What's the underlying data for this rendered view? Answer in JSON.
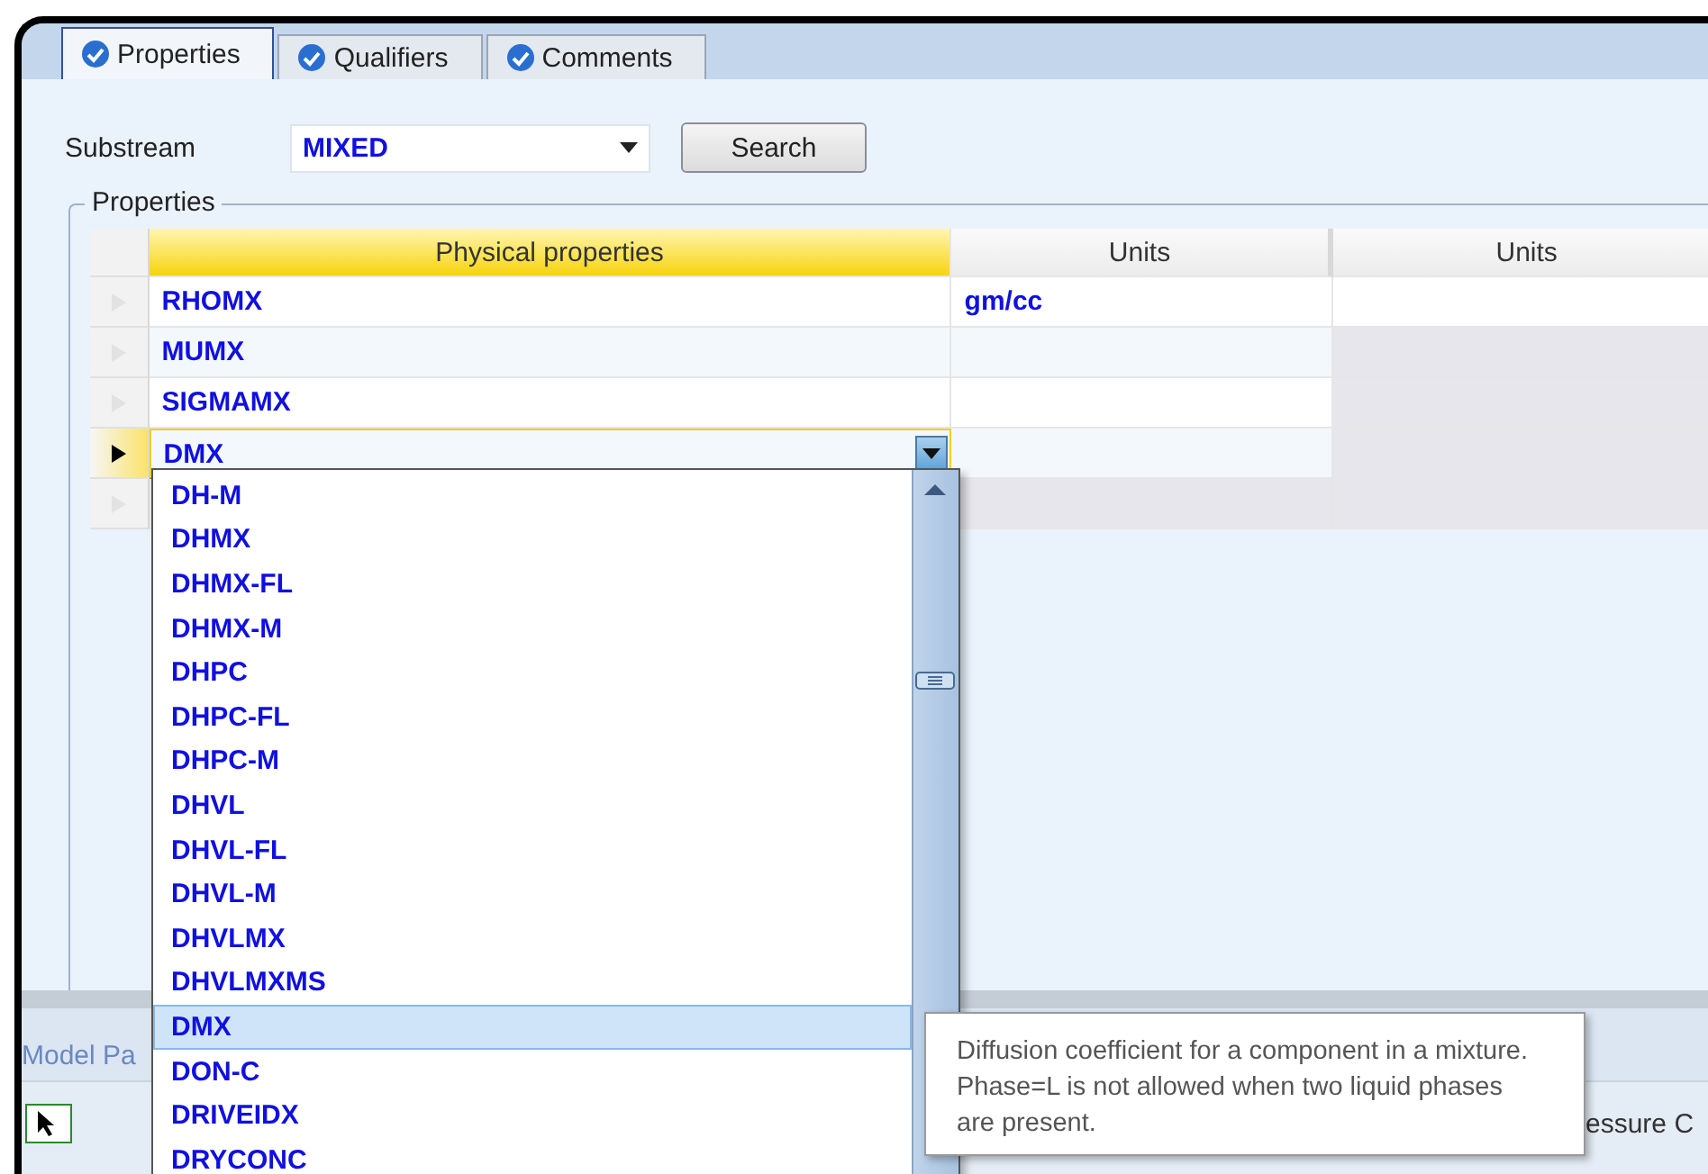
{
  "tabs": [
    {
      "label": "Properties",
      "selected": true
    },
    {
      "label": "Qualifiers",
      "selected": false
    },
    {
      "label": "Comments",
      "selected": false
    }
  ],
  "substream": {
    "label": "Substream",
    "value": "MIXED"
  },
  "search_button": "Search",
  "group_title": "Properties",
  "grid": {
    "columns": [
      "Physical properties",
      "Units",
      "Units"
    ],
    "rows": [
      {
        "name": "RHOMX",
        "units": "gm/cc",
        "units_2_disabled": false,
        "selected": false
      },
      {
        "name": "MUMX",
        "units_2_disabled": true,
        "selected": false
      },
      {
        "name": "SIGMAMX",
        "units_2_disabled": true,
        "selected": false
      },
      {
        "name": "DMX",
        "units_2_disabled": true,
        "selected": true
      },
      {
        "units_2_disabled": true,
        "selected": false
      }
    ]
  },
  "dropdown": {
    "items": [
      {
        "label": "DH-M",
        "selected": false
      },
      {
        "label": "DHMX",
        "selected": false
      },
      {
        "label": "DHMX-FL",
        "selected": false
      },
      {
        "label": "DHMX-M",
        "selected": false
      },
      {
        "label": "DHPC",
        "selected": false
      },
      {
        "label": "DHPC-FL",
        "selected": false
      },
      {
        "label": "DHPC-M",
        "selected": false
      },
      {
        "label": "DHVL",
        "selected": false
      },
      {
        "label": "DHVL-FL",
        "selected": false
      },
      {
        "label": "DHVL-M",
        "selected": false
      },
      {
        "label": "DHVLMX",
        "selected": false
      },
      {
        "label": "DHVLMXMS",
        "selected": false
      },
      {
        "label": "DMX",
        "selected": true
      },
      {
        "label": "DON-C",
        "selected": false
      },
      {
        "label": "DRIVEIDX",
        "selected": false
      },
      {
        "label": "DRYCONC",
        "selected": false
      }
    ]
  },
  "tooltip": "Diffusion coefficient for a component in a mixture. Phase=L is not allowed when two liquid phases are present.",
  "bottom_panel": {
    "title": "Model Pa",
    "right_text": "essure C"
  }
}
